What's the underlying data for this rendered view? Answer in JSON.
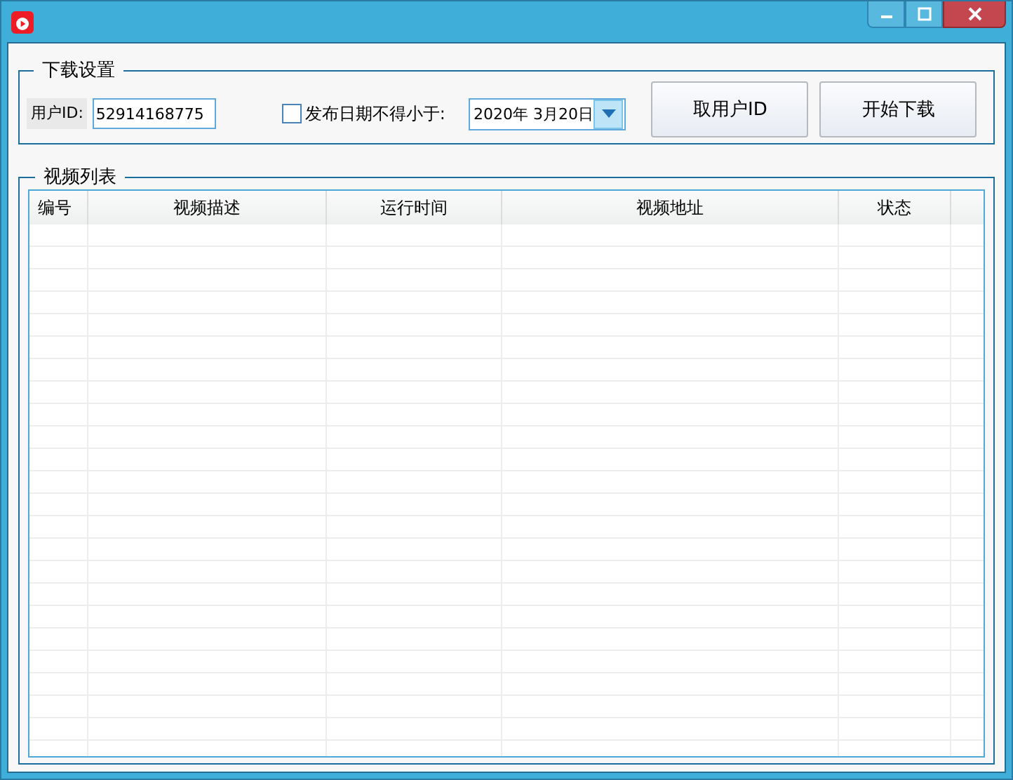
{
  "download_settings": {
    "title": "下载设置",
    "user_id_label": "用户ID:",
    "user_id_value": "52914168775",
    "date_filter": {
      "label": "发布日期不得小于:",
      "checked": false,
      "value": "2020年 3月20日"
    },
    "buttons": [
      "取用户ID",
      "开始下载"
    ]
  },
  "video_list": {
    "title": "视频列表",
    "columns": [
      "编号",
      "视频描述",
      "运行时间",
      "视频地址",
      "状态"
    ]
  }
}
